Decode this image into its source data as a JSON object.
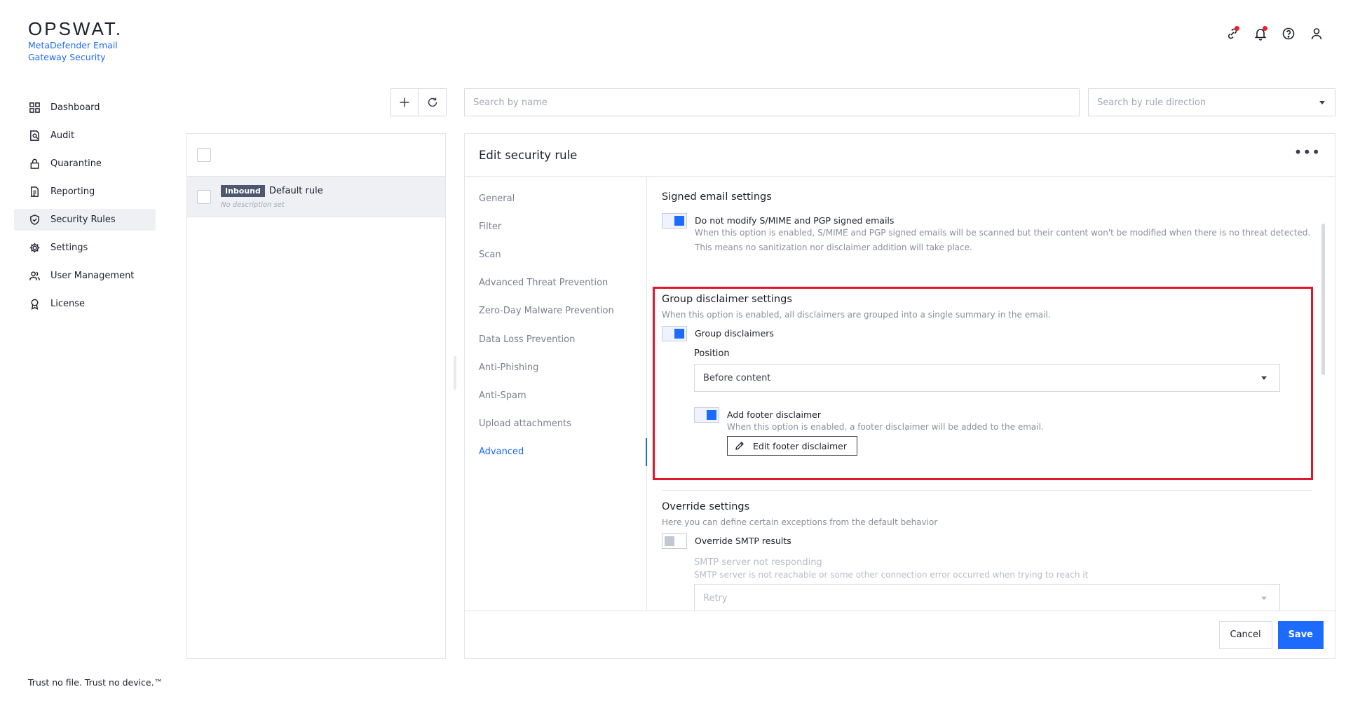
{
  "brand": {
    "logo": "OPSWAT.",
    "product_line1": "MetaDefender Email",
    "product_line2": "Gateway Security",
    "tagline": "Trust no file. Trust no device.™"
  },
  "sidebar": {
    "items": [
      {
        "label": "Dashboard",
        "icon": "dashboard-icon"
      },
      {
        "label": "Audit",
        "icon": "audit-icon"
      },
      {
        "label": "Quarantine",
        "icon": "lock-icon"
      },
      {
        "label": "Reporting",
        "icon": "document-icon"
      },
      {
        "label": "Security Rules",
        "icon": "shield-check-icon",
        "active": true
      },
      {
        "label": "Settings",
        "icon": "gear-icon"
      },
      {
        "label": "User Management",
        "icon": "users-icon"
      },
      {
        "label": "License",
        "icon": "award-icon"
      }
    ]
  },
  "search": {
    "name_placeholder": "Search by name",
    "direction_placeholder": "Search by rule direction"
  },
  "rules_list": {
    "rules": [
      {
        "direction": "Inbound",
        "name": "Default rule",
        "description": "No description set"
      }
    ]
  },
  "editor": {
    "title": "Edit security rule",
    "tabs": [
      "General",
      "Filter",
      "Scan",
      "Advanced Threat Prevention",
      "Zero-Day Malware Prevention",
      "Data Loss Prevention",
      "Anti-Phishing",
      "Anti-Spam",
      "Upload attachments",
      "Advanced"
    ],
    "active_tab": "Advanced",
    "signed": {
      "title": "Signed email settings",
      "toggle_label": "Do not modify S/MIME and PGP signed emails",
      "help1": "When this option is enabled, S/MIME and PGP signed emails will be scanned but their content won't be modified when there is no threat detected.",
      "help2": "This means no sanitization nor disclaimer addition will take place."
    },
    "group": {
      "title": "Group disclaimer settings",
      "help": "When this option is enabled, all disclaimers are grouped into a single summary in the email.",
      "toggle_label": "Group disclaimers",
      "position_label": "Position",
      "position_value": "Before content",
      "footer_label": "Add footer disclaimer",
      "footer_help": "When this option is enabled, a footer disclaimer will be added to the email.",
      "edit_footer_button": "Edit footer disclaimer"
    },
    "override": {
      "title": "Override settings",
      "help": "Here you can define certain exceptions from the default behavior",
      "toggle_label": "Override SMTP results",
      "smtp_label": "SMTP server not responding",
      "smtp_help": "SMTP server is not reachable or some other connection error occurred when trying to reach it",
      "smtp_value": "Retry"
    },
    "cancel_label": "Cancel",
    "save_label": "Save"
  },
  "colors": {
    "accent": "#1d6bfc",
    "highlight_box": "#e2162a",
    "notification_dot": "#e8222f"
  }
}
